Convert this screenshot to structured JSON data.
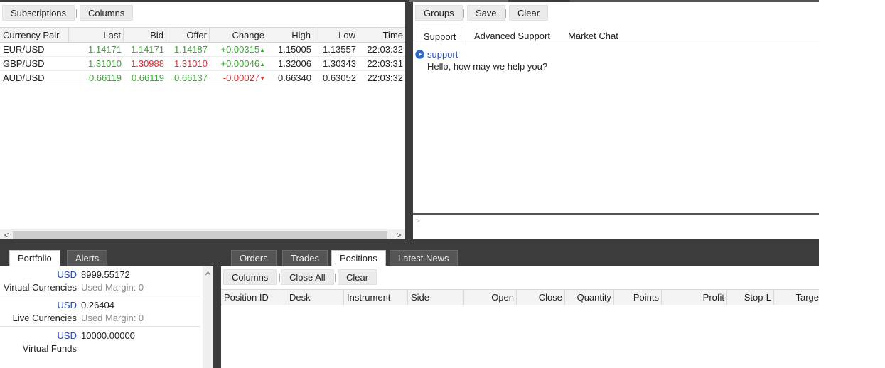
{
  "quotes_toolbar": {
    "subscriptions": "Subscriptions",
    "columns": "Columns"
  },
  "quotes_table": {
    "headers": [
      "Currency Pair",
      "Last",
      "Bid",
      "Offer",
      "Change",
      "High",
      "Low",
      "Time"
    ],
    "rows": [
      {
        "pair": "EUR/USD",
        "last": "1.14171",
        "bid": "1.14171",
        "offer": "1.14187",
        "change": "+0.00315",
        "high": "1.15005",
        "low": "1.13557",
        "time": "22:03:32"
      },
      {
        "pair": "GBP/USD",
        "last": "1.31010",
        "bid": "1.30988",
        "offer": "1.31010",
        "change": "+0.00046",
        "high": "1.32006",
        "low": "1.30343",
        "time": "22:03:31"
      },
      {
        "pair": "AUD/USD",
        "last": "0.66119",
        "bid": "0.66119",
        "offer": "0.66137",
        "change": "-0.00027",
        "high": "0.66340",
        "low": "0.63052",
        "time": "22:03:32"
      }
    ],
    "arrow_up": "▲",
    "arrow_down": "▼"
  },
  "scrollbar": {
    "left_arrow": "<",
    "right_arrow": ">"
  },
  "chat_toolbar": {
    "groups": "Groups",
    "save": "Save",
    "clear": "Clear"
  },
  "chat_tabs": [
    "Support",
    "Advanced Support",
    "Market Chat"
  ],
  "chat": {
    "sender": "support",
    "message": "Hello, how may we help you?",
    "input_prompt": ">"
  },
  "left_tabs": [
    "Portfolio",
    "Alerts"
  ],
  "portfolio": [
    {
      "currency": "USD",
      "value": "8999.55172",
      "label": "Virtual Currencies",
      "margin": "Used Margin: 0"
    },
    {
      "currency": "USD",
      "value": "0.26404",
      "label": "Live Currencies",
      "margin": "Used Margin: 0"
    },
    {
      "currency": "USD",
      "value": "10000.00000",
      "label": "Virtual Funds",
      "margin": ""
    }
  ],
  "bottom_tabs": [
    "Orders",
    "Trades",
    "Positions",
    "Latest News"
  ],
  "positions_toolbar": {
    "columns": "Columns",
    "close_all": "Close All",
    "clear": "Clear"
  },
  "positions_headers": [
    "Position ID",
    "Desk",
    "Instrument",
    "Side",
    "Open",
    "Close",
    "Quantity",
    "Points",
    "Profit",
    "Stop-L",
    "Targe"
  ],
  "colors": {
    "up": "#3aa535",
    "down": "#d8302f",
    "currency": "#2a4ca8",
    "frame": "#3c3c3c"
  }
}
